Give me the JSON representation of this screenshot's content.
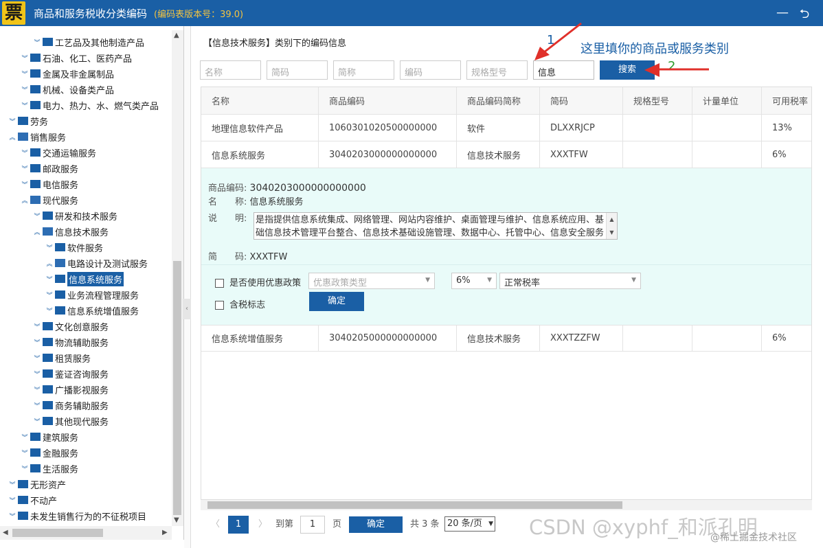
{
  "app": {
    "logo_char": "票",
    "title": "商品和服务税收分类编码",
    "version": "(编码表版本号：39.0)",
    "minimize": "—",
    "back": "⮌"
  },
  "tree": [
    {
      "label": "工艺品及其他制造产品",
      "level": 3
    },
    {
      "label": "石油、化工、医药产品",
      "level": 2
    },
    {
      "label": "金属及非金属制品",
      "level": 2
    },
    {
      "label": "机械、设备类产品",
      "level": 2
    },
    {
      "label": "电力、热力、水、燃气类产品",
      "level": 2
    },
    {
      "label": "劳务",
      "level": 1
    },
    {
      "label": "销售服务",
      "level": 1
    },
    {
      "label": "交通运输服务",
      "level": 2
    },
    {
      "label": "邮政服务",
      "level": 2
    },
    {
      "label": "电信服务",
      "level": 2
    },
    {
      "label": "现代服务",
      "level": 2
    },
    {
      "label": "研发和技术服务",
      "level": 3
    },
    {
      "label": "信息技术服务",
      "level": 3
    },
    {
      "label": "软件服务",
      "level": 4
    },
    {
      "label": "电路设计及测试服务",
      "level": 4
    },
    {
      "label": "信息系统服务",
      "level": 4
    },
    {
      "label": "业务流程管理服务",
      "level": 4
    },
    {
      "label": "信息系统增值服务",
      "level": 4
    },
    {
      "label": "文化创意服务",
      "level": 3
    },
    {
      "label": "物流辅助服务",
      "level": 3
    },
    {
      "label": "租赁服务",
      "level": 3
    },
    {
      "label": "鉴证咨询服务",
      "level": 3
    },
    {
      "label": "广播影视服务",
      "level": 3
    },
    {
      "label": "商务辅助服务",
      "level": 3
    },
    {
      "label": "其他现代服务",
      "level": 3
    },
    {
      "label": "建筑服务",
      "level": 2
    },
    {
      "label": "金融服务",
      "level": 2
    },
    {
      "label": "生活服务",
      "level": 2
    },
    {
      "label": "无形资产",
      "level": 1
    },
    {
      "label": "不动产",
      "level": 1
    },
    {
      "label": "未发生销售行为的不征税项目",
      "level": 1
    }
  ],
  "main": {
    "section_title": "【信息技术服务】类别下的编码信息",
    "filters": {
      "name": "名称",
      "short_code": "简码",
      "short_name": "简称",
      "code": "编码",
      "spec": "规格型号",
      "keyword_value": "信息"
    },
    "search_label": "搜索",
    "annotation_1": "1",
    "annotation_text": "这里填你的商品或服务类别",
    "annotation_2": "2"
  },
  "table": {
    "headers": [
      "名称",
      "商品编码",
      "商品编码简称",
      "简码",
      "规格型号",
      "计量单位",
      "可用税率"
    ],
    "rows": [
      [
        "地理信息软件产品",
        "1060301020500000000",
        "软件",
        "DLXXRJCP",
        "",
        "",
        "13%"
      ],
      [
        "信息系统服务",
        "3040203000000000000",
        "信息技术服务",
        "XXXTFW",
        "",
        "",
        "6%"
      ],
      [
        "信息系统增值服务",
        "3040205000000000000",
        "信息技术服务",
        "XXXTZZFW",
        "",
        "",
        "6%"
      ]
    ]
  },
  "detail": {
    "code_label": "商品编码:",
    "code": "3040203000000000000",
    "name_label": "名　　称:",
    "name": "信息系统服务",
    "desc_label": "说　　明:",
    "desc_line1": "是指提供信息系统集成、网络管理、网站内容维护、桌面管理与维护、信息系统应用、基",
    "desc_line2": "础信息技术管理平台整合、信息技术基础设施管理、数据中心、托管中心、信息安全服务",
    "short_label": "简　　码:",
    "short": "XXXTFW",
    "preferential_label": "是否使用优惠政策",
    "preferential_placeholder": "优惠政策类型",
    "rate": "6%",
    "rate_type": "正常税率",
    "tax_inclusive_label": "含税标志",
    "confirm_label": "确定"
  },
  "pager": {
    "prev": "〈",
    "current": "1",
    "next": "〉",
    "goto_label": "到第",
    "goto_value": "1",
    "page_unit": "页",
    "ok_label": "确定",
    "total": "共 3 条",
    "page_size": "20 条/页"
  },
  "watermark": {
    "main": "CSDN @xyphf_和派孔明",
    "sub": "@稀土掘金技术社区"
  },
  "colors": {
    "brand": "#1a5fa5",
    "detail_bg": "#e9fbf9",
    "annotation_red": "#e0302a",
    "annotation_green": "#2a9a2a"
  }
}
